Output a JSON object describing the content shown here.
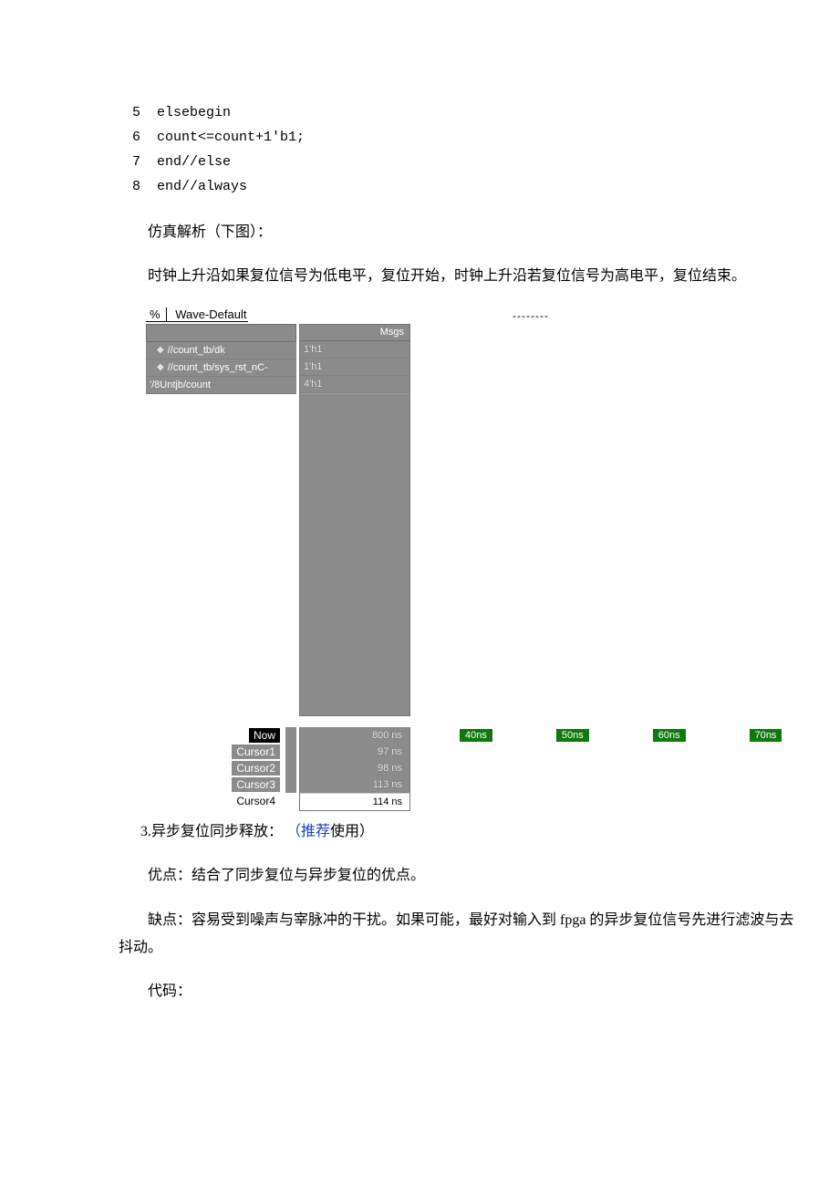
{
  "code": {
    "lines": [
      {
        "n": "5",
        "t": "elsebegin"
      },
      {
        "n": "6",
        "t": "count<=count+1'b1;"
      },
      {
        "n": "7",
        "t": "end//else"
      },
      {
        "n": "8",
        "t": "end//always"
      }
    ]
  },
  "paras": {
    "sim_title": "仿真解析（下图）：",
    "sim_desc": "时钟上升沿如果复位信号为低电平，复位开始，时钟上升沿若复位信号为高电平，复位结束。",
    "sec3_num": "3.异步复位同步释放：",
    "sec3_link": "（推荐",
    "sec3_tail": "使用）",
    "pros": "优点：结合了同步复位与异步复位的优点。",
    "cons": "缺点：容易受到噪声与宰脉冲的干扰。如果可能，最好对输入到 fpga 的异步复位信号先进行滤波与去抖动。",
    "code_label": "代码："
  },
  "wave": {
    "title_pct": "%",
    "title_text": "Wave-Default",
    "dash": "--------",
    "msgs": "Msgs",
    "signals": [
      {
        "name": "//count_tb/dk",
        "val": "1'h1"
      },
      {
        "name": "//count_tb/sys_rst_nC-",
        "val": "1'h1"
      },
      {
        "name": "'/8Untjb/count",
        "val": "4'h1"
      }
    ],
    "cursors": {
      "now": {
        "label": "Now",
        "val": "800 ns"
      },
      "c1": {
        "label": "Cursor1",
        "val": "97 ns"
      },
      "c2": {
        "label": "Cursor2",
        "val": "98 ns"
      },
      "c3": {
        "label": "Cursor3",
        "val": "113 ns"
      },
      "c4": {
        "label": "Cursor4",
        "val": "114 ns"
      }
    },
    "ticks": [
      "40ns",
      "50ns",
      "60ns",
      "70ns"
    ]
  }
}
